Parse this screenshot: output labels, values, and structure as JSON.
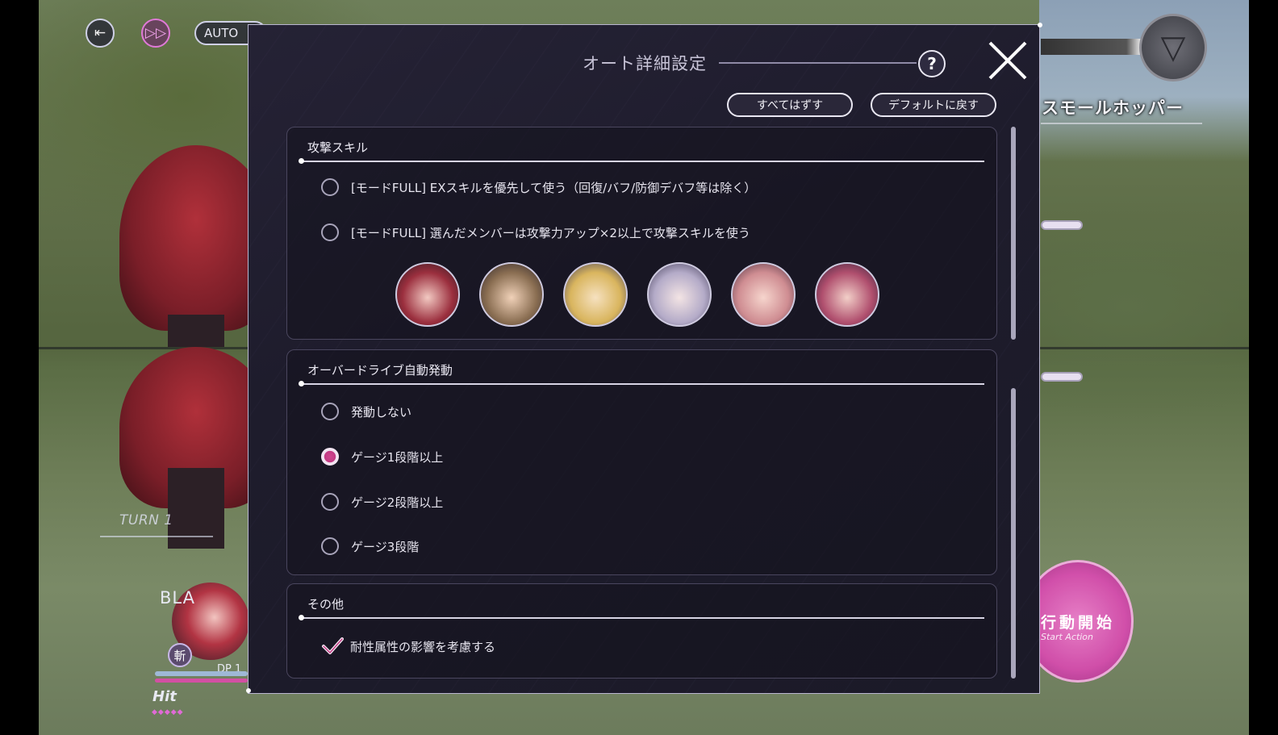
{
  "hud": {
    "auto_label": "AUTO",
    "turn_label": "TURN 1",
    "character_name": "BLA",
    "attribute_icon_label": "斬",
    "dp_label": "DP 1",
    "hit_label": "Hit"
  },
  "enemy": {
    "name": "スモールホッパー"
  },
  "start_button": {
    "label": "行動開始",
    "sub_label": "Start Action"
  },
  "modal": {
    "title": "オート詳細設定",
    "help_label": "?",
    "clear_all_label": "すべてはずす",
    "reset_default_label": "デフォルトに戻す",
    "sections": [
      {
        "title": "攻撃スキル",
        "options": [
          {
            "label": "[モードFULL] EXスキルを優先して使う（回復/バフ/防御デバフ等は除く）",
            "selected": false
          },
          {
            "label": "[モードFULL] 選んだメンバーは攻撃力アップ×2以上で攻撃スキルを使う",
            "selected": false
          }
        ],
        "members": [
          {
            "name": "member-1",
            "color": "#9b2f3e"
          },
          {
            "name": "member-2",
            "color": "#8a6e52"
          },
          {
            "name": "member-3",
            "color": "#d9b55e"
          },
          {
            "name": "member-4",
            "color": "#b4abc8"
          },
          {
            "name": "member-5",
            "color": "#cf8d92"
          },
          {
            "name": "member-6",
            "color": "#b04f6e"
          }
        ]
      },
      {
        "title": "オーバードライブ自動発動",
        "options": [
          {
            "label": "発動しない",
            "selected": false
          },
          {
            "label": "ゲージ1段階以上",
            "selected": true
          },
          {
            "label": "ゲージ2段階以上",
            "selected": false
          },
          {
            "label": "ゲージ3段階",
            "selected": false
          }
        ]
      },
      {
        "title": "その他",
        "options": [
          {
            "label": "耐性属性の影響を考慮する",
            "checked": true
          }
        ]
      }
    ]
  },
  "colors": {
    "accent": "#d0468f",
    "panel": "#1e1c2c",
    "border": "#b9b6cf"
  }
}
